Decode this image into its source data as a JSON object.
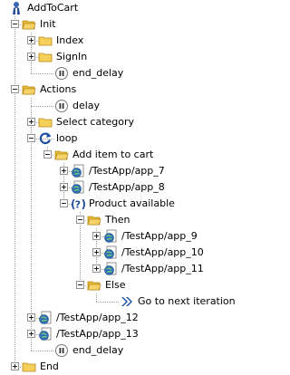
{
  "tree": {
    "root": "AddToCart",
    "init": "Init",
    "index": "Index",
    "signin": "SignIn",
    "end_delay_1": "end_delay",
    "actions": "Actions",
    "delay": "delay",
    "select_category": "Select category",
    "loop": "loop",
    "add_item": "Add item to cart",
    "app7": "/TestApp/app_7",
    "app8": "/TestApp/app_8",
    "product_available": "Product available",
    "then": "Then",
    "app9": "/TestApp/app_9",
    "app10": "/TestApp/app_10",
    "app11": "/TestApp/app_11",
    "else": "Else",
    "go_next": "Go to next iteration",
    "app12": "/TestApp/app_12",
    "app13": "/TestApp/app_13",
    "end_delay_2": "end_delay",
    "end": "End"
  },
  "icons": {
    "folder": "folder-icon",
    "page": "page-globe-icon",
    "delay": "pause-icon",
    "loop": "loop-icon",
    "condition": "question-icon",
    "next": "double-chevron-icon",
    "user": "user-icon"
  },
  "colors": {
    "folder": "#f2c94c",
    "folder_edge": "#c9a227",
    "page": "#2e6fb7",
    "accent": "#1f4fa0"
  }
}
